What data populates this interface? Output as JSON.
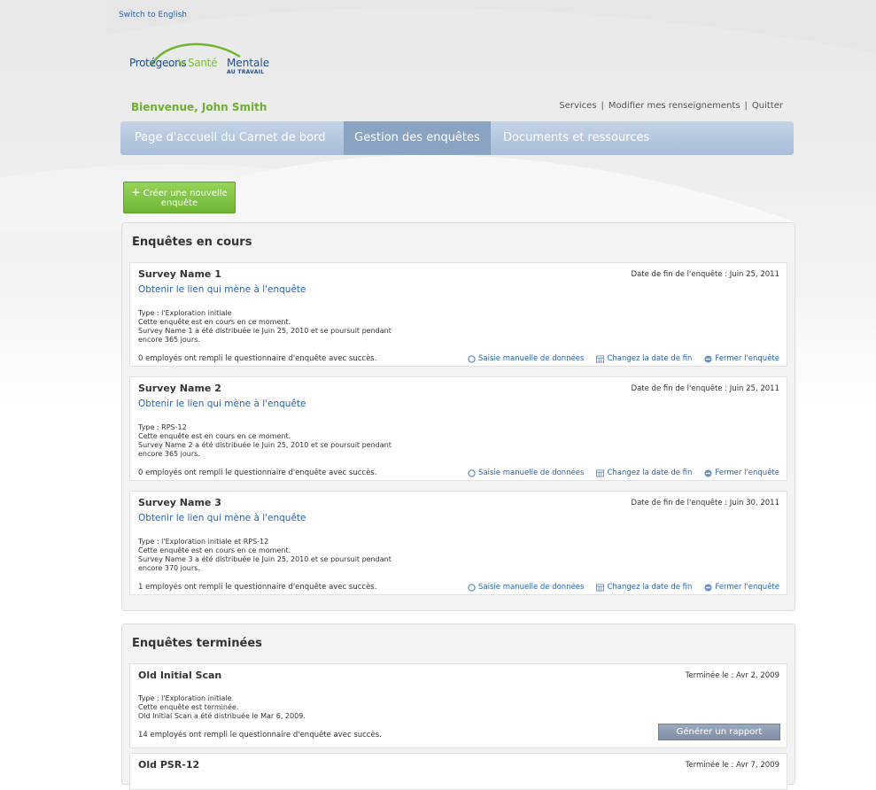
{
  "header": {
    "switch_language": "Switch to English",
    "logo": {
      "part1": "Protégeons",
      "part2": "la",
      "part3": "Santé",
      "part4": "Mentale",
      "part5": "AU TRAVAIL"
    },
    "welcome": "Bienvenue, John Smith",
    "links": [
      "Services",
      "Modifier mes renseignements",
      "Quitter"
    ]
  },
  "nav": {
    "tabs": [
      "Page d'accueil du Carnet de bord",
      "Gestion des enquêtes",
      "Documents et ressources"
    ],
    "active_tab": "Gestion des enquêtes"
  },
  "create_button": {
    "plus": "+",
    "line1": "Créer une nouvelle",
    "line2": "enquête"
  },
  "ongoing": {
    "title": "Enquêtes en cours",
    "link_label": "Obtenir le lien qui mène à l'enquête",
    "actions": [
      "Saisie manuelle de données",
      "Changez la date de fin",
      "Fermer l'enquête"
    ],
    "surveys": [
      {
        "name": "Survey Name 1",
        "end_date": "Date de fin de l'enquête : Juin 25, 2011",
        "type": "Type : l'Exploration initiale",
        "status": "Cette enquête est en cours en ce moment.",
        "distributed": "Survey Name 1 a été distribuée le Juin 25, 2010 et se poursuit pendant",
        "remaining": "encore 365 jours.",
        "count": "0 employés ont rempli le questionnaire d'enquête avec succès."
      },
      {
        "name": "Survey Name 2",
        "end_date": "Date de fin de l'enquête : Juin 25, 2011",
        "type": "Type : RPS-12",
        "status": "Cette enquête est en cours en ce moment.",
        "distributed": "Survey Name 2 a été distribuée le Juin 25, 2010 et se poursuit pendant",
        "remaining": "encore 365 jours.",
        "count": "0 employés ont rempli le questionnaire d'enquête avec succès."
      },
      {
        "name": "Survey Name 3",
        "end_date": "Date de fin de l'enquête : Juin 30, 2011",
        "type": "Type : l'Exploration initiale et RPS-12",
        "status": "Cette enquête est en cours en ce moment.",
        "distributed": "Survey Name 3 a été distribuée le Juin 25, 2010 et se poursuit pendant",
        "remaining": "encore 370 jours.",
        "count": "1 employés ont rempli le questionnaire d'enquête avec succès."
      }
    ]
  },
  "completed": {
    "title": "Enquêtes terminées",
    "report_button": "Générer un rapport",
    "surveys": [
      {
        "name": "Old Initial Scan",
        "end_date": "Terminée le : Avr 2, 2009",
        "type": "Type : l'Exploration initiale",
        "status": "Cette enquête est terminée.",
        "distributed": "Old Initial Scan a été distribuée le Mar 6, 2009.",
        "count": "14 employés ont rempli le questionnaire d'enquête avec succès."
      },
      {
        "name": "Old PSR-12",
        "end_date": "Terminée le : Avr 7, 2009"
      }
    ]
  }
}
